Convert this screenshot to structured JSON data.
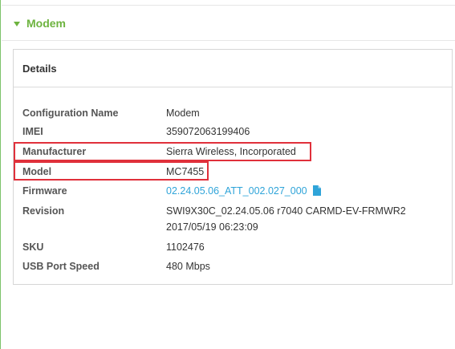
{
  "section": {
    "title": "Modem",
    "icon": "collapse-triangle-icon"
  },
  "panel": {
    "title": "Details"
  },
  "details": {
    "configuration_name": {
      "label": "Configuration Name",
      "value": "Modem"
    },
    "imei": {
      "label": "IMEI",
      "value": "359072063199406"
    },
    "manufacturer": {
      "label": "Manufacturer",
      "value": "Sierra Wireless, Incorporated"
    },
    "model": {
      "label": "Model",
      "value": "MC7455"
    },
    "firmware": {
      "label": "Firmware",
      "value": "02.24.05.06_ATT_002.027_000",
      "icon": "file-icon"
    },
    "revision": {
      "label": "Revision",
      "value": "SWI9X30C_02.24.05.06 r7040 CARMD-EV-FRMWR2",
      "value2": "2017/05/19 06:23:09"
    },
    "sku": {
      "label": "SKU",
      "value": "1102476"
    },
    "usb_port_speed": {
      "label": "USB Port Speed",
      "value": "480 Mbps"
    }
  },
  "colors": {
    "accent": "#6db33f",
    "link": "#2fa4d9",
    "highlight": "#e0303b"
  }
}
